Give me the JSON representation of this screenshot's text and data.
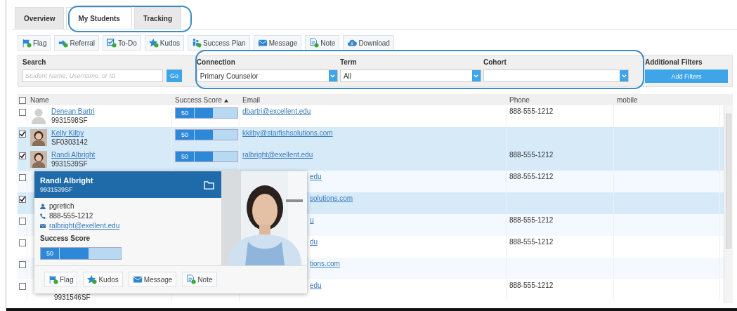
{
  "tabs": [
    {
      "label": "Overview",
      "selected": false
    },
    {
      "label": "My Students",
      "selected": true
    },
    {
      "label": "Tracking",
      "selected": false
    }
  ],
  "toolbar": [
    {
      "label": "Flag",
      "kind": "flag"
    },
    {
      "label": "Referral",
      "kind": "referral"
    },
    {
      "label": "To-Do",
      "kind": "todo"
    },
    {
      "label": "Kudos",
      "kind": "kudos"
    },
    {
      "label": "Success Plan",
      "kind": "plan"
    },
    {
      "label": "Message",
      "kind": "message"
    },
    {
      "label": "Note",
      "kind": "note"
    },
    {
      "label": "Download",
      "kind": "download"
    }
  ],
  "search": {
    "label": "Search",
    "placeholder": "Student Name, Username, or ID",
    "button": "Go"
  },
  "filters": [
    {
      "label": "Connection",
      "value": "Primary Counselor"
    },
    {
      "label": "Term",
      "value": "All"
    },
    {
      "label": "Cohort"
    }
  ],
  "additional_filters": {
    "label": "Additional Filters",
    "button": "Add Filters"
  },
  "table": {
    "select_all": false,
    "columns": [
      {
        "label": "Name",
        "sorted": false
      },
      {
        "label": "Success Score",
        "sorted": true
      },
      {
        "label": "Email",
        "sorted": false
      },
      {
        "label": "Phone",
        "sorted": false
      },
      {
        "label": "mobile",
        "sorted": false
      }
    ],
    "rows": [
      {
        "kind": "no-photo",
        "checked": false,
        "name": "Denean Bartri",
        "id": "9931598SF",
        "score": "50",
        "level": 0.6,
        "email": "dbartri@excellent.edu",
        "phone": "888-555-1212"
      },
      {
        "checked": true,
        "name": "Kelly Kilby",
        "id": "SF0303142",
        "score": "50",
        "level": 0.6,
        "email": "kkilby@starfishsolutions.com"
      },
      {
        "checked": true,
        "name": "Randi Albright",
        "id": "9931539SF",
        "score": "50",
        "level": 0.6,
        "email": "ralbright@exellent.edu",
        "phone": "888-555-1212"
      },
      {
        "kind": "covered",
        "checked": false,
        "email": "edu",
        "phone": "888-555-1212"
      },
      {
        "kind": "covered",
        "checked": true,
        "email": "solutions.com"
      },
      {
        "kind": "covered",
        "checked": false,
        "email": "u",
        "phone": "888-555-1212"
      },
      {
        "kind": "covered",
        "checked": false,
        "email": "du",
        "phone": "888-555-1212"
      },
      {
        "kind": "covered",
        "checked": false,
        "email": "tions.com"
      },
      {
        "kind": "covered",
        "checked": false,
        "id": "9931546SF",
        "email": "edu",
        "phone": "888-555-1212"
      }
    ]
  },
  "popup": {
    "name": "Randi Albright",
    "id": "9931539SF",
    "username": "pgretich",
    "phone": "888-555-1212",
    "email": "ralbright@exellent.edu",
    "score_label": "Success Score",
    "score": "50",
    "level": 0.6,
    "buttons": [
      {
        "label": "Flag",
        "kind": "flag"
      },
      {
        "label": "Kudos",
        "kind": "kudos"
      },
      {
        "label": "Message",
        "kind": "message"
      },
      {
        "label": "Note",
        "kind": "note"
      }
    ]
  }
}
